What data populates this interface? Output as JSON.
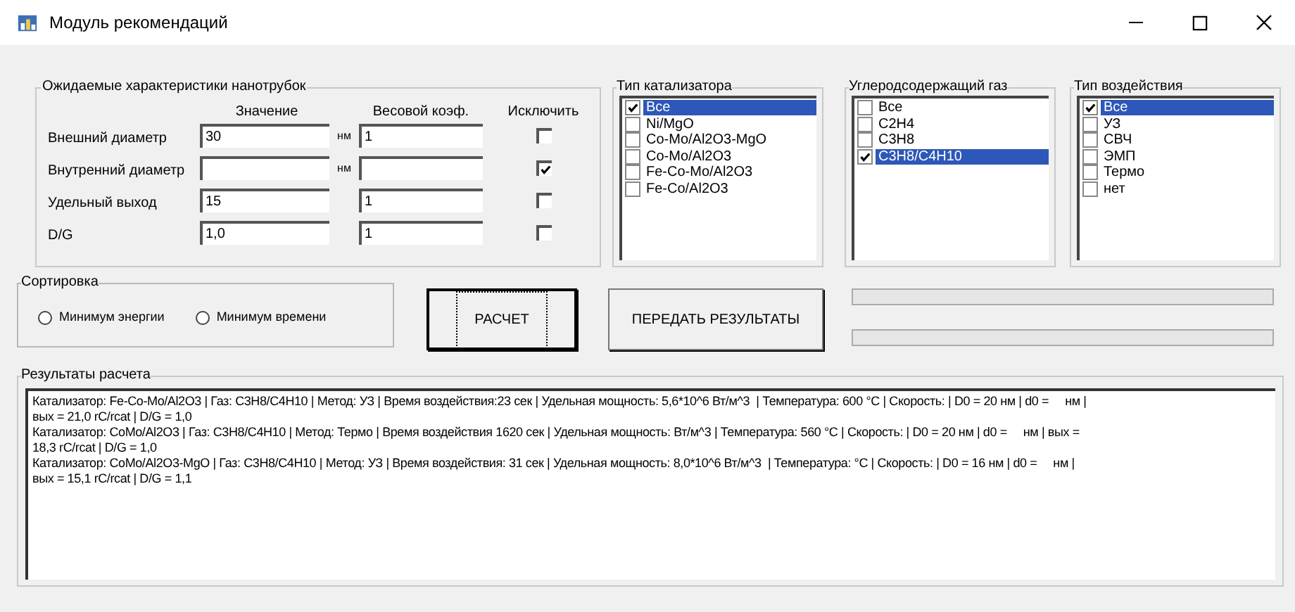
{
  "window": {
    "title": "Модуль рекомендаций"
  },
  "characteristics": {
    "title": "Ожидаемые характеристики нанотрубок",
    "columns": [
      "Значение",
      "Весовой коэф.",
      "Исключить"
    ],
    "rows": [
      {
        "label": "Внешний диаметр",
        "value": "30",
        "unit": "нм",
        "weight": "1",
        "excluded": false
      },
      {
        "label": "Внутренний диаметр",
        "unit": "нм",
        "excluded": true
      },
      {
        "label": "Удельный выход",
        "value": "15",
        "weight": "1",
        "excluded": false
      },
      {
        "label": "D/G",
        "value": "1,0",
        "weight": "1",
        "excluded": false
      }
    ]
  },
  "lists": [
    {
      "title": "Тип катализатора",
      "items": [
        {
          "label": "Все",
          "checked": true,
          "selected": true
        },
        {
          "label": "Ni/MgO",
          "checked": false,
          "selected": false
        },
        {
          "label": "Co-Mo/Al2O3-MgO",
          "checked": false,
          "selected": false
        },
        {
          "label": "Co-Mo/Al2O3",
          "checked": false,
          "selected": false
        },
        {
          "label": "Fe-Co-Mo/Al2O3",
          "checked": false,
          "selected": false
        },
        {
          "label": "Fe-Co/Al2O3",
          "checked": false,
          "selected": false
        }
      ]
    },
    {
      "title": "Углеродсодержащий газ",
      "items": [
        {
          "label": "Все",
          "checked": false,
          "selected": false
        },
        {
          "label": "C2H4",
          "checked": false,
          "selected": false
        },
        {
          "label": "C3H8",
          "checked": false,
          "selected": false
        },
        {
          "label": "C3H8/C4H10",
          "checked": true,
          "selected": true
        }
      ]
    },
    {
      "title": "Тип воздействия",
      "items": [
        {
          "label": "Все",
          "checked": true,
          "selected": true
        },
        {
          "label": "УЗ",
          "checked": false,
          "selected": false
        },
        {
          "label": "СВЧ",
          "checked": false,
          "selected": false
        },
        {
          "label": "ЭМП",
          "checked": false,
          "selected": false
        },
        {
          "label": "Термо",
          "checked": false,
          "selected": false
        },
        {
          "label": "нет",
          "checked": false,
          "selected": false
        }
      ]
    }
  ],
  "sorting": {
    "title": "Сортировка",
    "options": [
      {
        "label": "Минимум энергии",
        "selected": false
      },
      {
        "label": "Минимум времени",
        "selected": false
      }
    ]
  },
  "buttons": [
    {
      "label": "РАСЧЕТ",
      "focused": true
    },
    {
      "label": "ПЕРЕДАТЬ РЕЗУЛЬТАТЫ",
      "focused": false
    }
  ],
  "progress": [
    {
      "kind": "bar"
    },
    {
      "kind": "bar"
    }
  ],
  "results": {
    "title": "Результаты расчета",
    "lines": [
      "Катализатор: Fe-Co-Mo/Al2O3 | Газ: C3H8/C4H10 | Метод: УЗ | Время воздействия:23 сек | Удельная мощность: 5,6*10^6 Вт/м^3  | Температура: 600 °C | Скорость: | D0 = 20 нм | d0 =     нм |",
      "вых = 21,0 rC/rcat | D/G = 1,0",
      "Катализатор: CoMo/Al2O3 | Газ: C3H8/C4H10 | Метод: Термо | Время воздействия 1620 сек | Удельная мощность: Вт/м^3 | Температура: 560 °C | Скорость: | D0 = 20 нм | d0 =     нм | вых =",
      "18,3 rC/rcat | D/G = 1,0",
      "Катализатор: CoMo/Al2O3-MgO | Газ: C3H8/C4H10 | Метод: УЗ | Время воздействия: 31 сек | Удельная мощность: 8,0*10^6 Вт/м^3  | Температура: °C | Скорость: | D0 = 16 нм | d0 =     нм |",
      "вых = 15,1 rC/rcat | D/G = 1,1"
    ]
  }
}
